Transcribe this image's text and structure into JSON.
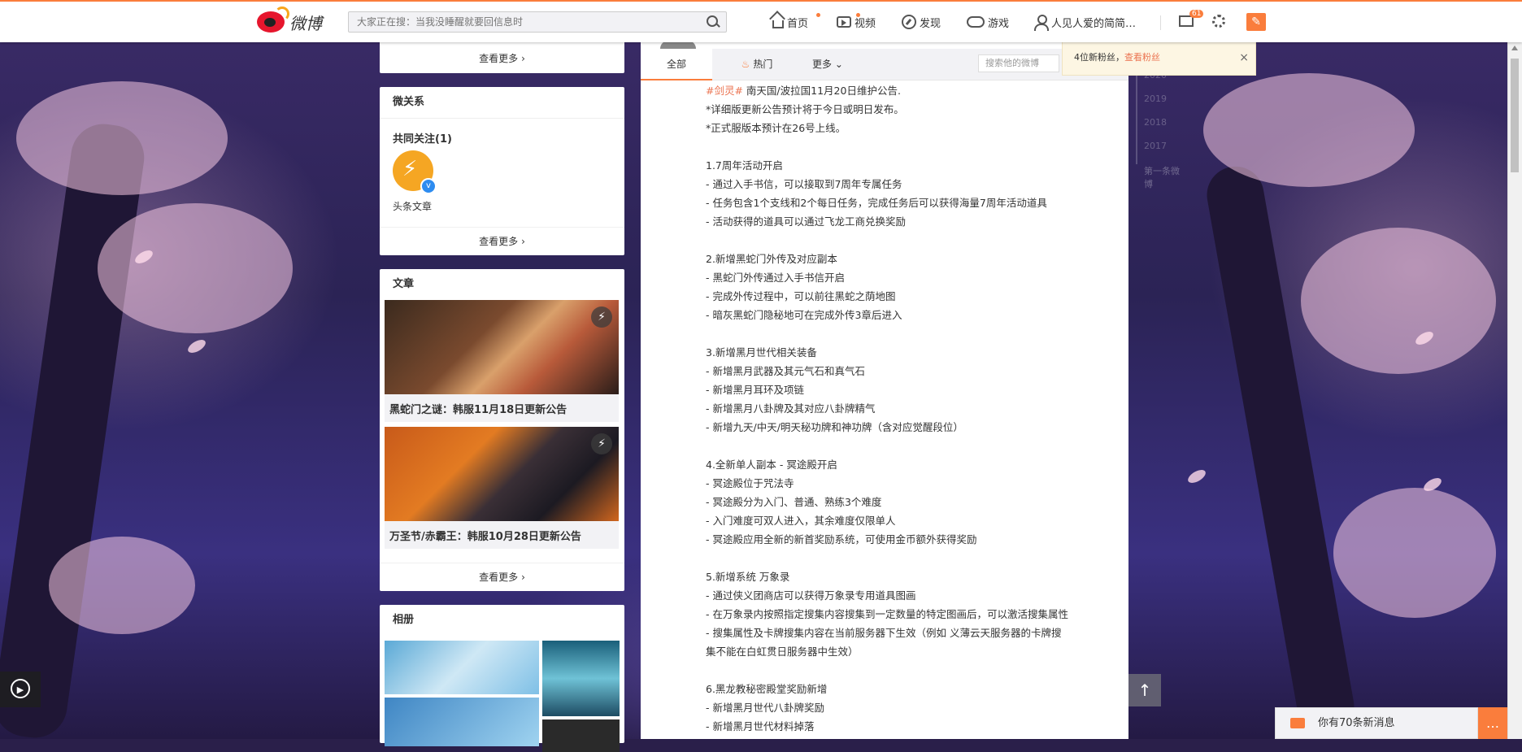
{
  "topbar": {
    "logo_text": "微博",
    "search_placeholder": "大家正在搜：当我没睡醒就要回信息时",
    "nav": {
      "home": "首页",
      "video": "视频",
      "discover": "发现",
      "game": "游戏",
      "user": "人见人爱的简简…"
    },
    "mail_badge": "61",
    "accent": "#fa7d3c"
  },
  "left": {
    "top_more": "查看更多",
    "relations": {
      "title": "微关系",
      "common_title": "共同关注(1)",
      "account_name": "头条文章",
      "more": "查看更多"
    },
    "articles": {
      "title": "文章",
      "items": [
        {
          "caption": "黑蛇门之谜：韩服11月18日更新公告"
        },
        {
          "caption": "万圣节/赤霸王：韩服10月28日更新公告"
        }
      ],
      "more": "查看更多"
    },
    "album": {
      "title": "相册"
    }
  },
  "feed": {
    "tabs": {
      "all": "全部",
      "hot": "热门",
      "more": "更多"
    },
    "search_placeholder": "搜索他的微博",
    "post": {
      "topic": "#剑灵#",
      "lines": [
        " 南天国/波拉国11月20日维护公告.",
        "*详细版更新公告预计将于今日或明日发布。",
        "*正式服版本预计在26号上线。",
        "",
        "1.7周年活动开启",
        "- 通过入手书信，可以接取到7周年专属任务",
        "- 任务包含1个支线和2个每日任务，完成任务后可以获得海量7周年活动道具",
        "- 活动获得的道具可以通过飞龙工商兑换奖励",
        "",
        "2.新增黑蛇门外传及对应副本",
        "- 黑蛇门外传通过入手书信开启",
        "- 完成外传过程中，可以前往黑蛇之荫地图",
        "- 暗灰黑蛇门隐秘地可在完成外传3章后进入",
        "",
        "3.新增黑月世代相关装备",
        "- 新增黑月武器及其元气石和真气石",
        "- 新增黑月耳环及项链",
        "- 新增黑月八卦牌及其对应八卦牌精气",
        "- 新增九天/中天/明天秘功牌和神功牌（含对应觉醒段位）",
        "",
        "4.全新单人副本 - 冥途殿开启",
        "- 冥途殿位于咒法寺",
        "- 冥途殿分为入门、普通、熟练3个难度",
        "- 入门难度可双人进入，其余难度仅限单人",
        "- 冥途殿应用全新的新首奖励系统，可使用金币额外获得奖励",
        "",
        "5.新增系统 万象录",
        "- 通过侠义团商店可以获得万象录专用道具图画",
        "- 在万象录内按照指定搜集内容搜集到一定数量的特定图画后，可以激活搜集属性",
        "- 搜集属性及卡牌搜集内容在当前服务器下生效（例如 义薄云天服务器的卡牌搜",
        "集不能在白虹贯日服务器中生效）",
        "",
        "6.黑龙教秘密殿堂奖励新增",
        "- 新增黑月世代八卦牌奖励",
        "- 新增黑月世代材料掉落"
      ]
    }
  },
  "right": {
    "years": [
      "2020",
      "2019",
      "2018",
      "2017"
    ],
    "first_post": "第一条微博",
    "popup": {
      "text": "4位新粉丝，",
      "link": "查看粉丝",
      "close": "×"
    },
    "to_top": "↑",
    "msg_bar": "你有70条新消息",
    "chat": "…"
  }
}
